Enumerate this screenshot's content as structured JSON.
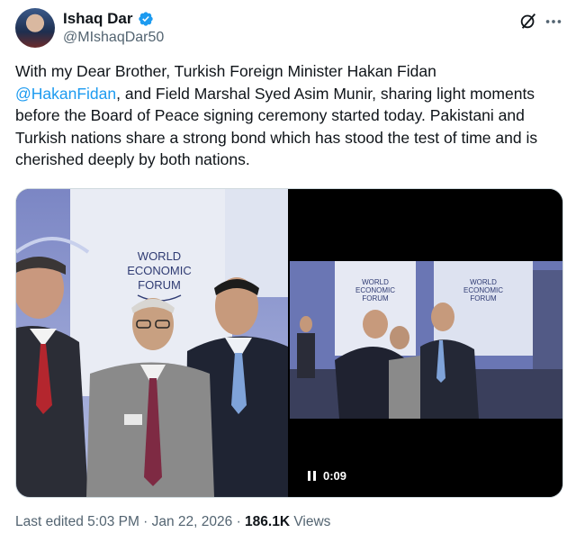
{
  "author": {
    "name": "Ishaq Dar",
    "handle": "@MIshaqDar50",
    "verified": true,
    "verified_color": "#1d9bf0"
  },
  "icons": {
    "grok": "grok-icon",
    "more": "more-options-icon",
    "pause": "pause-icon"
  },
  "tweet": {
    "text_part1": "With my Dear Brother, Turkish Foreign Minister Hakan Fidan",
    "mention": "@HakanFidan",
    "text_part2": ", and Field Marshal Syed Asim Munir, sharing light moments before the Board of Peace signing ceremony started today. Pakistani and Turkish nations share a strong bond which has stood the test of time and is cherished deeply by both nations.",
    "mention_color": "#1d9bf0"
  },
  "media": {
    "photo_left_sign": {
      "line1": "WORLD",
      "line2": "ECONOMIC",
      "line3": "FORUM"
    },
    "video_sign": {
      "line1": "WORLD",
      "line2": "ECONOMIC",
      "line3": "FORUM"
    },
    "video_time": "0:09"
  },
  "meta": {
    "edited": "Last edited 5:03 PM · Jan 22, 2026 · ",
    "views_count": "186.1K",
    "views_label": " Views"
  }
}
